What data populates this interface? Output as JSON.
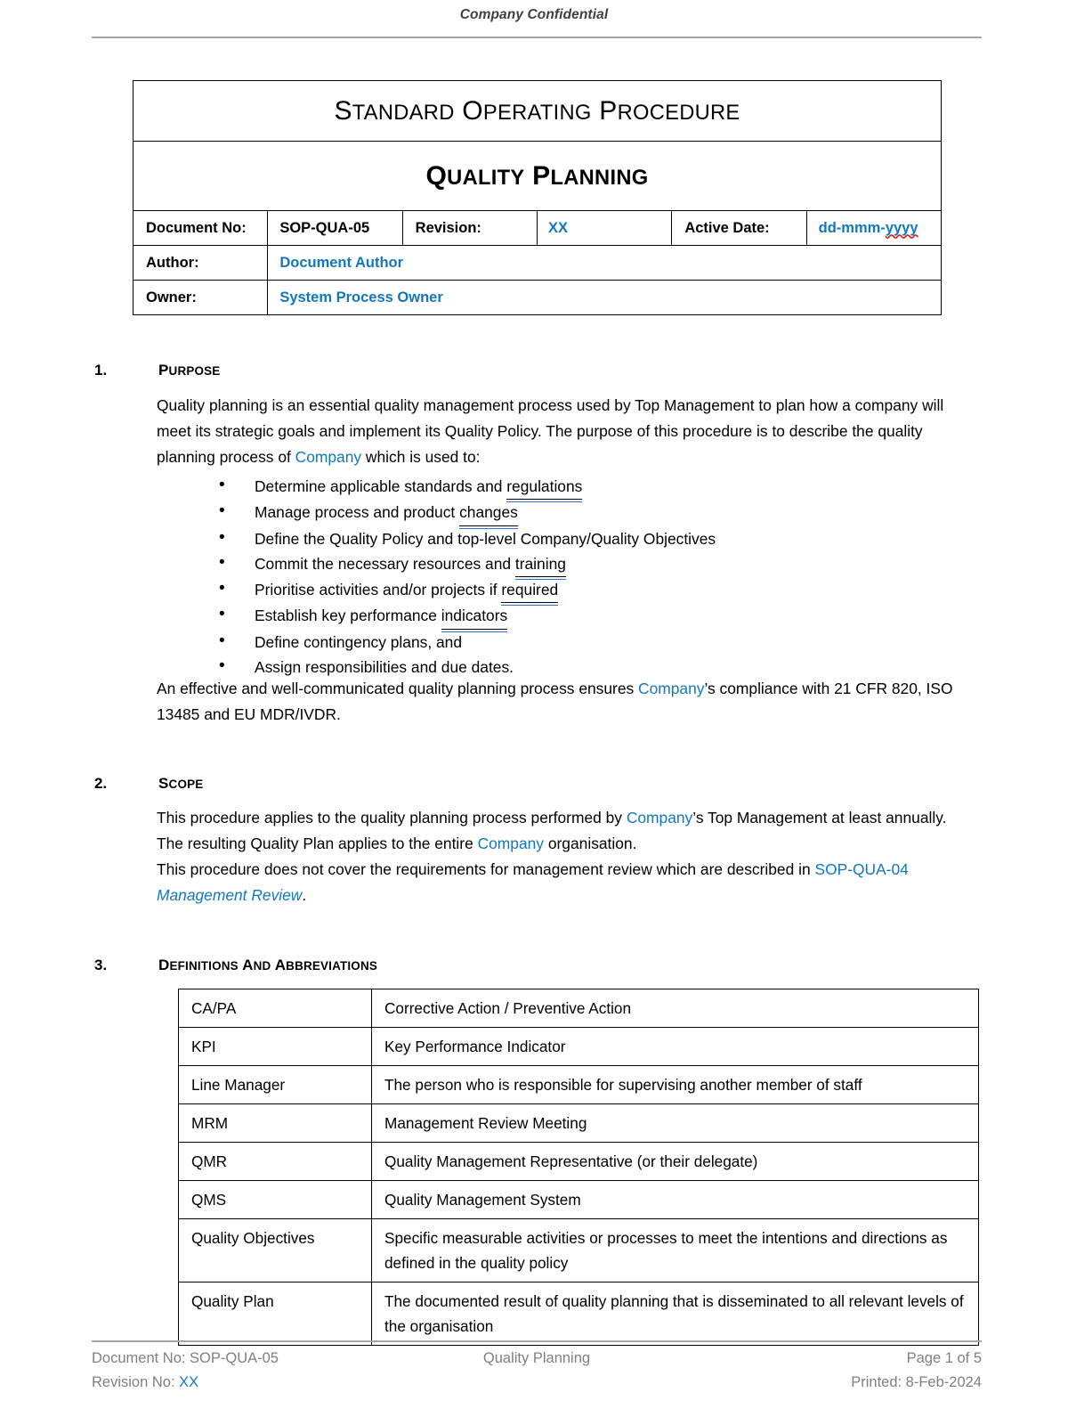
{
  "header": {
    "confidential": "Company Confidential"
  },
  "title_block": {
    "doc_type": "Standard Operating Procedure",
    "doc_title": "Quality Planning",
    "fields": {
      "document_no_label": "Document No:",
      "document_no_value": "SOP-QUA-05",
      "revision_label": "Revision:",
      "revision_value": "XX",
      "active_date_label": "Active Date:",
      "active_date_value_prefix": "dd-mmm-",
      "active_date_value_suffix": "yyyy",
      "author_label": "Author:",
      "author_value": "Document Author",
      "owner_label": "Owner:",
      "owner_value": "System Process Owner"
    }
  },
  "sections": [
    {
      "number": "1.",
      "heading": "Purpose",
      "para1_a": "Quality planning is an essential quality management process used by Top Management to plan how a company will meet its strategic goals and implement its Quality Policy. The purpose of this procedure is to describe the quality planning process of ",
      "para1_company": "Company",
      "para1_b": " which is used to:",
      "bullets": [
        {
          "pre": "Determine applicable standards and ",
          "marked": "regulations",
          "post": ""
        },
        {
          "pre": "Manage process and product ",
          "marked": "changes",
          "post": ""
        },
        {
          "pre": "Define the Quality Policy and top-level Company/Quality Objectives",
          "marked": "",
          "post": ""
        },
        {
          "pre": "Commit the necessary resources and ",
          "marked": "training",
          "post": ""
        },
        {
          "pre": "Prioritise activities and/or projects if ",
          "marked": "required",
          "post": ""
        },
        {
          "pre": "Establish key performance ",
          "marked": "indicators",
          "post": ""
        },
        {
          "pre": "Define contingency plans, and",
          "marked": "",
          "post": ""
        },
        {
          "pre": "Assign responsibilities and due dates.",
          "marked": "",
          "post": ""
        }
      ],
      "para2_a": "An effective and well-communicated quality planning process ensures ",
      "para2_company": "Company",
      "para2_b": "’s compliance with 21 CFR 820, ISO 13485 and EU MDR/IVDR."
    },
    {
      "number": "2.",
      "heading": "Scope",
      "para1_a": "This procedure applies to the quality planning process performed by ",
      "para1_company1": "Company",
      "para1_b": "’s Top Management at least annually. The resulting Quality Plan applies to the entire ",
      "para1_company2": "Company",
      "para1_c": " organisation.",
      "para2_a": "This procedure does not cover the requirements for management review which are described in ",
      "para2_link": "SOP-QUA-04 ",
      "para2_link_ital": "Management Review",
      "para2_b": "."
    },
    {
      "number": "3.",
      "heading": "Definitions and Abbreviations"
    }
  ],
  "definitions": [
    {
      "term": "CA/PA",
      "definition": "Corrective Action / Preventive Action"
    },
    {
      "term": "KPI",
      "definition": "Key Performance Indicator"
    },
    {
      "term": "Line Manager",
      "definition": "The person who is responsible for supervising another member of staff"
    },
    {
      "term": "MRM",
      "definition": "Management Review Meeting"
    },
    {
      "term": "QMR",
      "definition": "Quality Management Representative (or their delegate)"
    },
    {
      "term": "QMS",
      "definition": "Quality Management System"
    },
    {
      "term": "Quality Objectives",
      "definition": "Specific measurable activities or processes to meet the intentions and directions as defined in the quality policy"
    },
    {
      "term": "Quality Plan",
      "definition": "The documented result of quality planning that is disseminated to all relevant levels of the organisation"
    }
  ],
  "footer": {
    "document_no": "Document No: SOP-QUA-05",
    "revision_label": "Revision No: ",
    "revision_value": "XX",
    "center_title": "Quality Planning",
    "page": "Page 1 of 5",
    "printed": "Printed:  8-Feb-2024"
  },
  "colors": {
    "accent_blue": "#1278be",
    "footer_gray": "#808080",
    "rule_gray": "#a6a6a6",
    "spellcheck_red": "#e01b1b",
    "grammar_blue": "#2d6fd6"
  }
}
